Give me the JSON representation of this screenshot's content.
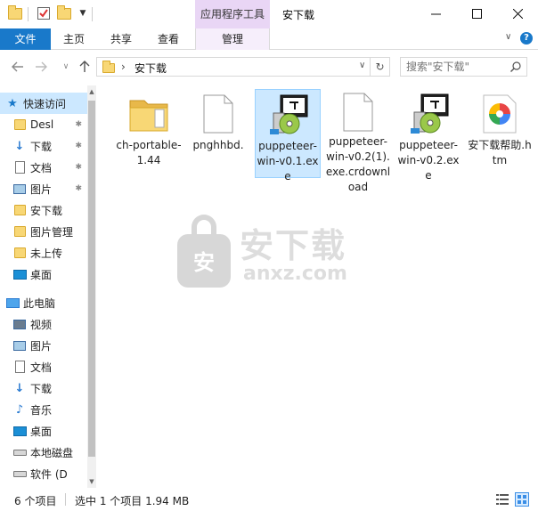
{
  "titlebar": {
    "context_tab": "应用程序工具",
    "title": "安下载"
  },
  "ribbon": {
    "file": "文件",
    "home": "主页",
    "share": "共享",
    "view": "查看",
    "manage": "管理"
  },
  "address": {
    "separator": "›",
    "path": "安下载",
    "search_placeholder": "搜索\"安下载\""
  },
  "sidebar": {
    "quick_access": "快速访问",
    "items": [
      {
        "label": "Desl",
        "icon": "folder-icon",
        "pinned": true
      },
      {
        "label": "下载",
        "icon": "download-arrow-icon",
        "pinned": true
      },
      {
        "label": "文档",
        "icon": "document-icon",
        "pinned": true
      },
      {
        "label": "图片",
        "icon": "picture-icon",
        "pinned": true
      },
      {
        "label": "安下载",
        "icon": "folder-icon",
        "pinned": false
      },
      {
        "label": "图片管理",
        "icon": "folder-icon",
        "pinned": false
      },
      {
        "label": "未上传",
        "icon": "folder-icon",
        "pinned": false
      },
      {
        "label": "桌面",
        "icon": "desktop-icon",
        "pinned": false
      }
    ],
    "this_pc": "此电脑",
    "pc_items": [
      {
        "label": "视频",
        "icon": "video-icon"
      },
      {
        "label": "图片",
        "icon": "picture-icon"
      },
      {
        "label": "文档",
        "icon": "document-icon"
      },
      {
        "label": "下载",
        "icon": "download-arrow-icon"
      },
      {
        "label": "音乐",
        "icon": "music-note-icon"
      },
      {
        "label": "桌面",
        "icon": "desktop-icon"
      },
      {
        "label": "本地磁盘",
        "icon": "drive-icon"
      },
      {
        "label": "软件 (D",
        "icon": "drive-icon"
      }
    ]
  },
  "files": [
    {
      "name": "ch-portable-1.44",
      "type": "folder",
      "selected": false
    },
    {
      "name": "pnghhbd.",
      "type": "blank-file",
      "selected": false
    },
    {
      "name": "puppeteer-win-v0.1.exe",
      "type": "installer",
      "selected": true
    },
    {
      "name": "puppeteer-win-v0.2(1).exe.crdownload",
      "type": "blank-file",
      "selected": false
    },
    {
      "name": "puppeteer-win-v0.2.exe",
      "type": "installer",
      "selected": false
    },
    {
      "name": "安下载帮助.htm",
      "type": "html-file",
      "selected": false
    }
  ],
  "watermark": {
    "text": "安下载",
    "sub": "anxz.com"
  },
  "status": {
    "count": "6 个项目",
    "selection": "选中 1 个项目  1.94 MB"
  },
  "colors": {
    "file_tab": "#1979ca",
    "selection": "#cce8ff",
    "context_tab": "#e9d6f5"
  }
}
